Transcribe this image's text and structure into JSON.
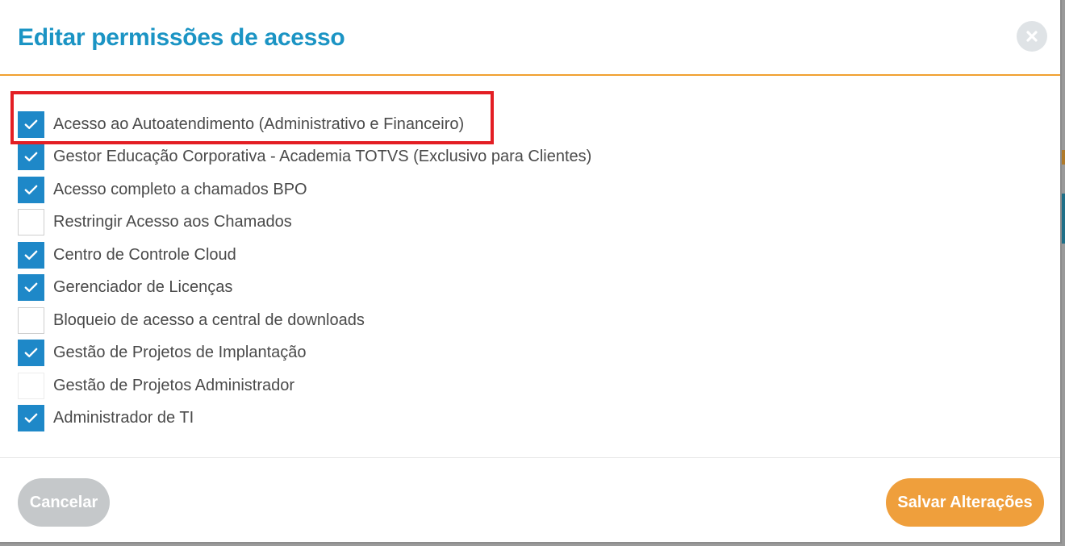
{
  "modal": {
    "title": "Editar permissões de acesso",
    "close_icon": "close-icon"
  },
  "permissions": [
    {
      "label": "Acesso ao Autoatendimento (Administrativo e Financeiro)",
      "checked": true
    },
    {
      "label": "Gestor Educação Corporativa - Academia TOTVS (Exclusivo para Clientes)",
      "checked": true
    },
    {
      "label": "Acesso completo a chamados BPO",
      "checked": true
    },
    {
      "label": "Restringir Acesso aos Chamados",
      "checked": false
    },
    {
      "label": "Centro de Controle Cloud",
      "checked": true
    },
    {
      "label": "Gerenciador de Licenças",
      "checked": true
    },
    {
      "label": "Bloqueio de acesso a central de downloads",
      "checked": false
    },
    {
      "label": "Gestão de Projetos de Implantação",
      "checked": true
    },
    {
      "label": "Gestão de Projetos Administrador",
      "checked": false
    },
    {
      "label": "Administrador de TI",
      "checked": true
    }
  ],
  "footer": {
    "cancel_label": "Cancelar",
    "save_label": "Salvar Alterações"
  },
  "colors": {
    "title": "#1b94c4",
    "header_rule": "#f0a030",
    "checkbox_checked": "#1e88c8",
    "cancel_button": "#c5c8ca",
    "save_button": "#ef9f3c",
    "highlight": "#e31e24"
  }
}
